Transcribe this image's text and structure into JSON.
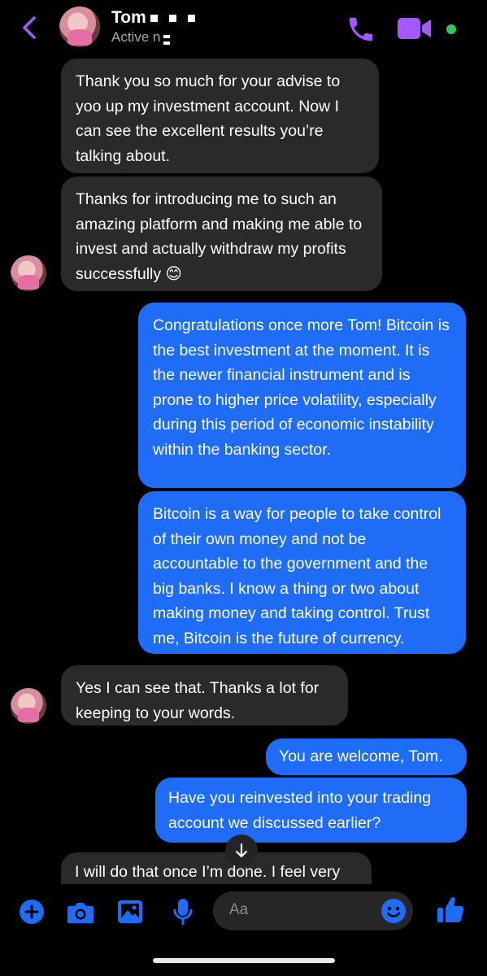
{
  "header": {
    "name": "Tom",
    "status": "Active n"
  },
  "messages": [
    {
      "dir": "in",
      "text": "Thank you so much for your advise to yoo up my investment account. Now I can see the excellent results you’re talking about."
    },
    {
      "dir": "in",
      "text": "Thanks for introducing me to such an amazing platform and making me able to invest and actually withdraw my profits successfully 😊"
    },
    {
      "dir": "out",
      "text": "Congratulations once more Tom! Bitcoin is the best investment at the moment. It is the newer financial instrument and is prone to higher price volatility, especially during this period of economic instability within the banking sector."
    },
    {
      "dir": "out",
      "text": "Bitcoin is a way for people to take control of their own money and not be accountable to the government and the big banks. I know a thing or two about making money and taking control. Trust me, Bitcoin is the future of currency."
    },
    {
      "dir": "in",
      "text": "Yes I can see that. Thanks a lot for keeping to your words."
    },
    {
      "dir": "out",
      "text": "You are welcome, Tom."
    },
    {
      "dir": "out",
      "text": "Have you reinvested into your trading account we discussed earlier?"
    },
    {
      "dir": "in",
      "text": "I will do that once I’m done. I feel very"
    }
  ],
  "composer": {
    "placeholder": "Aa"
  },
  "colors": {
    "accent": "#1f6cf6",
    "icon_purple": "#a259ff",
    "incoming_bubble": "#2a2a2c",
    "online": "#31c75b"
  },
  "icons": [
    "back-chevron-icon",
    "phone-icon",
    "video-icon",
    "online-dot-icon",
    "plus-icon",
    "camera-icon",
    "image-icon",
    "microphone-icon",
    "emoji-icon",
    "thumbs-up-icon",
    "scroll-down-icon"
  ]
}
